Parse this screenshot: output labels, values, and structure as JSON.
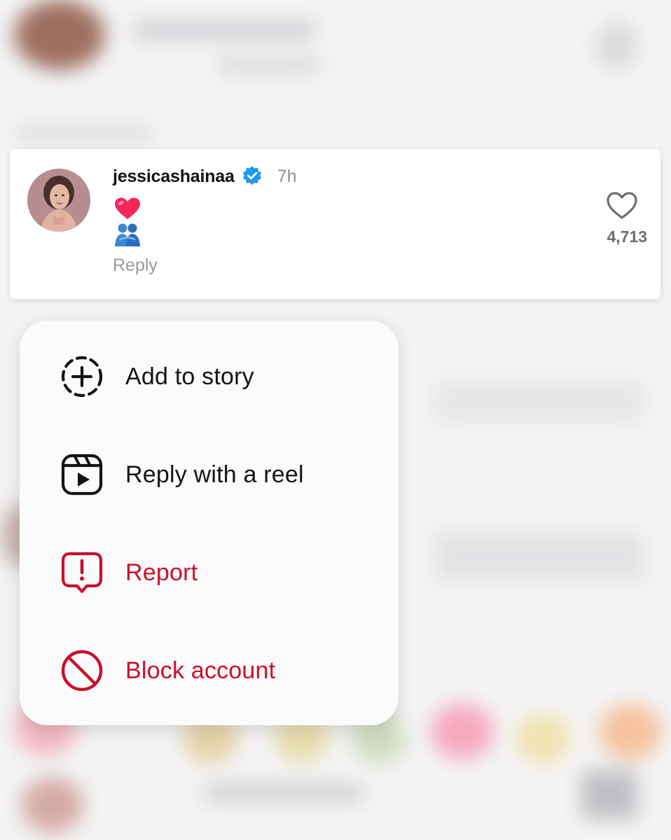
{
  "comment": {
    "username": "jessicashainaa",
    "verified": true,
    "time": "7h",
    "emojis": [
      "red-heart",
      "people-hugging"
    ],
    "reply_label": "Reply",
    "like_count": "4,713"
  },
  "menu": {
    "items": [
      {
        "label": "Add to story",
        "icon": "add-story-icon",
        "color": "#141414"
      },
      {
        "label": "Reply with a reel",
        "icon": "reel-icon",
        "color": "#141414"
      },
      {
        "label": "Report",
        "icon": "report-icon",
        "color": "#c8102e"
      },
      {
        "label": "Block account",
        "icon": "block-icon",
        "color": "#c8102e"
      }
    ]
  },
  "colors": {
    "verified_badge": "#1d9bf0",
    "destructive": "#c8102e",
    "muted_text": "#8e8e8e"
  }
}
